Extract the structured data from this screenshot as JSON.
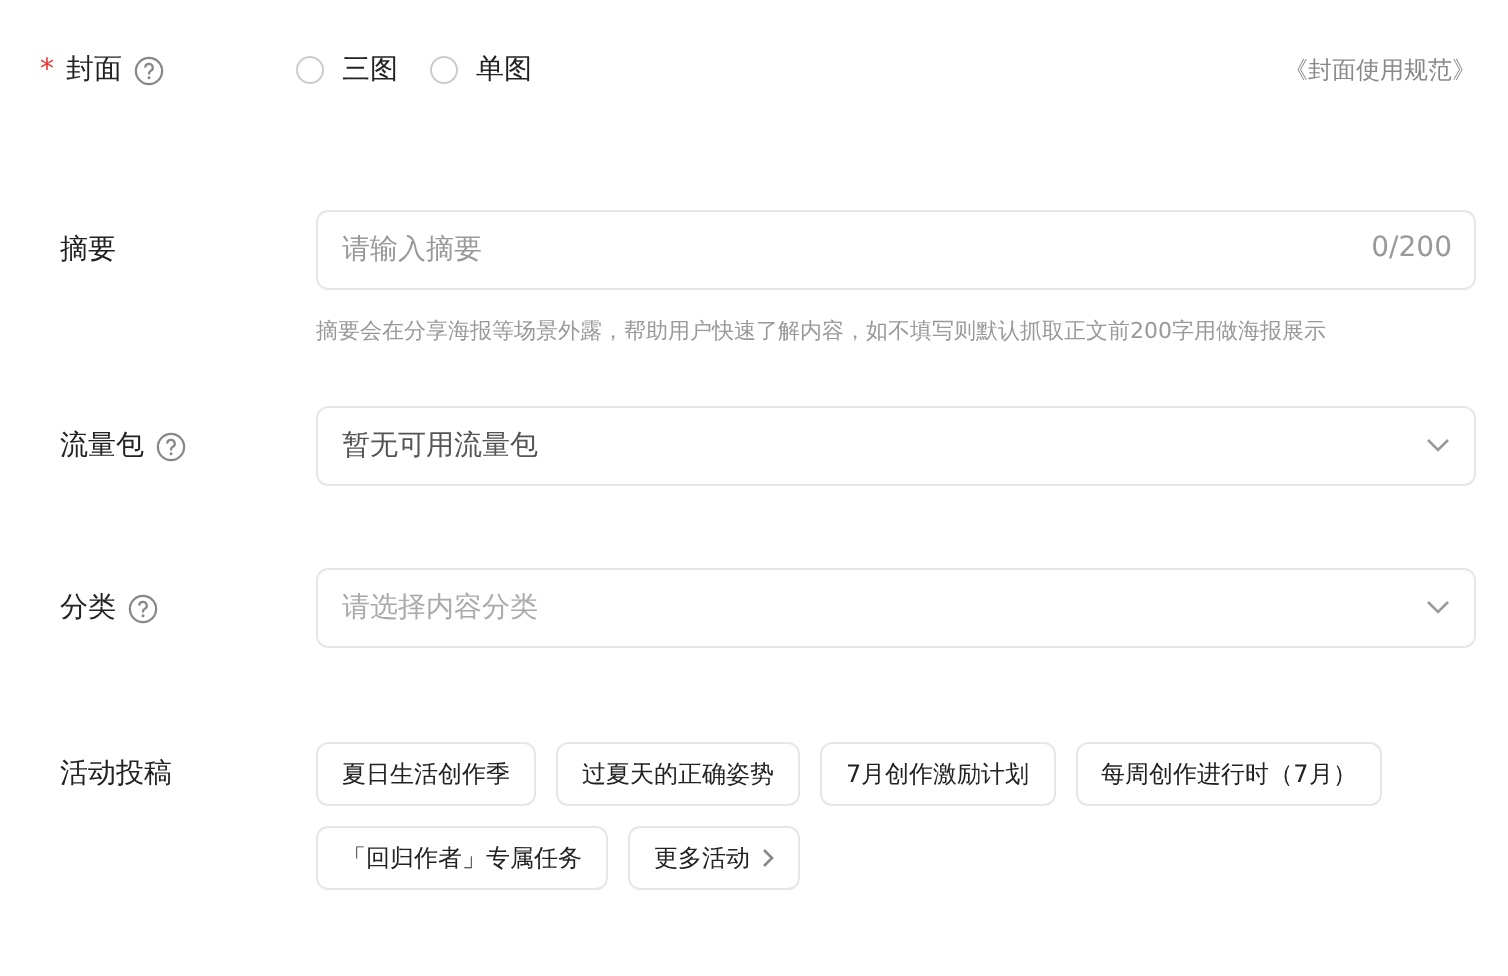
{
  "cover": {
    "label": "封面",
    "required_mark": "*",
    "options": [
      {
        "label": "三图",
        "selected": false
      },
      {
        "label": "单图",
        "selected": false
      }
    ],
    "link": "《封面使用规范》"
  },
  "summary": {
    "label": "摘要",
    "placeholder": "请输入摘要",
    "counter": "0/200",
    "hint": "摘要会在分享海报等场景外露，帮助用户快速了解内容，如不填写则默认抓取正文前200字用做海报展示"
  },
  "traffic": {
    "label": "流量包",
    "value": "暂无可用流量包"
  },
  "category": {
    "label": "分类",
    "placeholder": "请选择内容分类"
  },
  "activities": {
    "label": "活动投稿",
    "tags": [
      {
        "label": "夏日生活创作季",
        "kind": "tag"
      },
      {
        "label": "过夏天的正确姿势",
        "kind": "tag"
      },
      {
        "label": "7月创作激励计划",
        "kind": "tag"
      },
      {
        "label": "每周创作进行时（7月）",
        "kind": "tag"
      },
      {
        "label": "「回归作者」专属任务",
        "kind": "tag"
      },
      {
        "label": "更多活动",
        "kind": "more"
      }
    ]
  }
}
